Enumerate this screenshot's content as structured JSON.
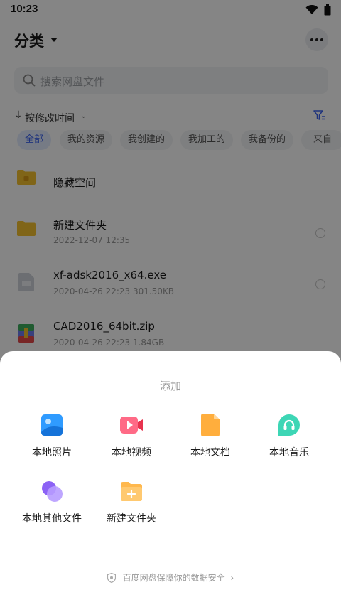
{
  "status_bar": {
    "time": "10:23",
    "icons": [
      "wifi-icon",
      "battery-icon"
    ]
  },
  "header": {
    "title": "分类",
    "more_icon": "more-dots-icon"
  },
  "search": {
    "placeholder": "搜索网盘文件"
  },
  "sort": {
    "arrow": "↓",
    "label": "按修改时间",
    "caret": "⌄"
  },
  "chips": [
    "全部",
    "我的资源",
    "我创建的",
    "我加工的",
    "我备份的",
    "来自"
  ],
  "files": [
    {
      "name": "隐藏空间",
      "meta": "",
      "icon": "folder-lock-icon"
    },
    {
      "name": "新建文件夹",
      "meta": "2022-12-07  12:35",
      "icon": "folder-icon"
    },
    {
      "name": "xf-adsk2016_x64.exe",
      "meta": "2020-04-26  22:23  301.50KB",
      "icon": "exe-file-icon"
    },
    {
      "name": "CAD2016_64bit.zip",
      "meta": "2020-04-26  22:23  1.84GB",
      "icon": "zip-file-icon"
    }
  ],
  "sheet": {
    "title": "添加",
    "items": [
      {
        "label": "本地照片",
        "icon": "photo-icon",
        "color": "#2f9bff"
      },
      {
        "label": "本地视频",
        "icon": "video-icon",
        "color": "#ff5c7a"
      },
      {
        "label": "本地文档",
        "icon": "document-icon",
        "color": "#ffae3d"
      },
      {
        "label": "本地音乐",
        "icon": "music-icon",
        "color": "#3dd6b5"
      },
      {
        "label": "本地其他文件",
        "icon": "other-files-icon",
        "color": "#8c62f5"
      },
      {
        "label": "新建文件夹",
        "icon": "new-folder-icon",
        "color": "#ffb84d"
      }
    ],
    "footer": "百度网盘保障你的数据安全",
    "footer_chevron": "›"
  },
  "colors": {
    "accent": "#3a62ef",
    "overlay": "rgba(0,0,0,0.48)"
  }
}
